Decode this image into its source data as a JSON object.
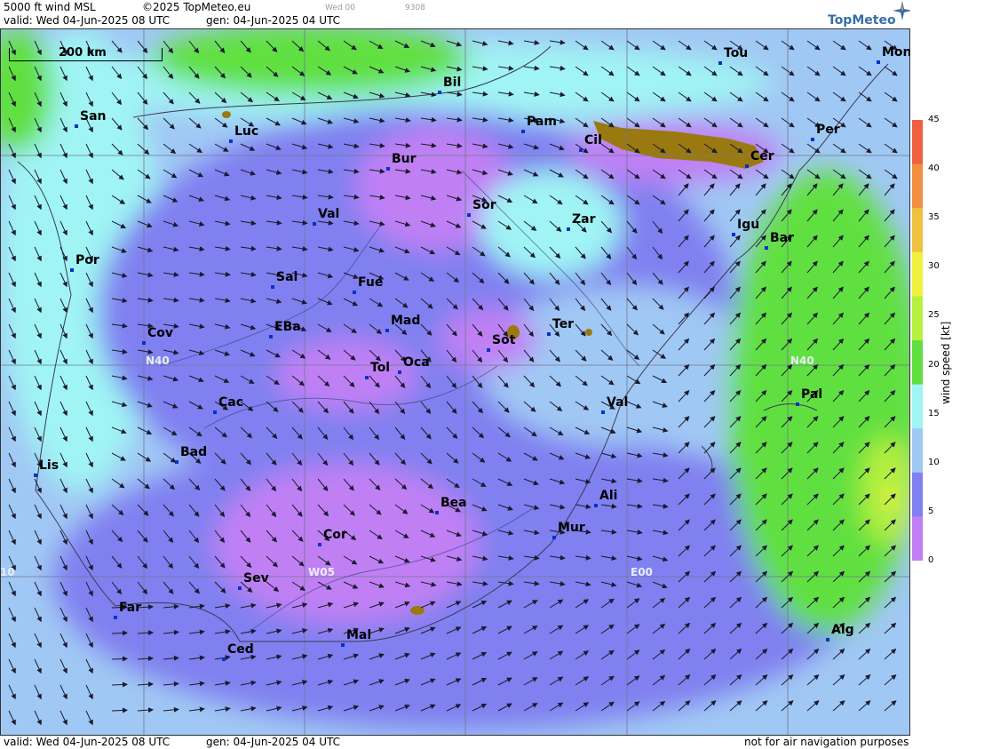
{
  "header": {
    "product": "5000 ft wind MSL",
    "copyright": "©2025 TopMeteo.eu",
    "run_small": "Wed 00",
    "code_small": "9308",
    "valid": "valid:  Wed  04-Jun-2025  08 UTC",
    "gen": "gen: 04-Jun-2025 04 UTC"
  },
  "logo": {
    "text": "TopMeteo",
    "icon": "compass-star-icon"
  },
  "scale": {
    "label": "200 km"
  },
  "grid_labels": {
    "lat_n40_left": "N40",
    "lat_n40_right": "N40",
    "lon_w05": "W05",
    "lon_e00": "E00",
    "lon_w10": "10"
  },
  "cities": [
    {
      "name": "Bil"
    },
    {
      "name": "Tou"
    },
    {
      "name": "Mon"
    },
    {
      "name": "San"
    },
    {
      "name": "Luc"
    },
    {
      "name": "Pam"
    },
    {
      "name": "Cil"
    },
    {
      "name": "Cer"
    },
    {
      "name": "Per"
    },
    {
      "name": "Bur"
    },
    {
      "name": "Sor"
    },
    {
      "name": "Zar"
    },
    {
      "name": "Igu"
    },
    {
      "name": "Bar"
    },
    {
      "name": "Val"
    },
    {
      "name": "Por"
    },
    {
      "name": "Sal"
    },
    {
      "name": "Fue"
    },
    {
      "name": "Mad"
    },
    {
      "name": "Ter"
    },
    {
      "name": "Cov"
    },
    {
      "name": "EBa"
    },
    {
      "name": "Sot"
    },
    {
      "name": "Tol"
    },
    {
      "name": "Oca"
    },
    {
      "name": "Pal"
    },
    {
      "name": "Cac"
    },
    {
      "name": "Val"
    },
    {
      "name": "Bad"
    },
    {
      "name": "Lis"
    },
    {
      "name": "Ali"
    },
    {
      "name": "Bea"
    },
    {
      "name": "Mur"
    },
    {
      "name": "Cor"
    },
    {
      "name": "Sev"
    },
    {
      "name": "Far"
    },
    {
      "name": "Mal"
    },
    {
      "name": "Alg"
    },
    {
      "name": "Ced"
    }
  ],
  "legend": {
    "title": "wind speed  [kt]",
    "ticks": [
      "45",
      "40",
      "35",
      "30",
      "25",
      "20",
      "15",
      "10",
      "5",
      "0"
    ],
    "colors": [
      "#f06040",
      "#f09040",
      "#f0c040",
      "#f0f040",
      "#b8f040",
      "#60e040",
      "#a0f4f4",
      "#a0c8f4",
      "#8080f0",
      "#c080f4"
    ]
  },
  "footer": {
    "valid": "valid:  Wed  04-Jun-2025  08 UTC",
    "gen": "gen: 04-Jun-2025 04 UTC",
    "disclaimer": "not for air navigation purposes"
  }
}
